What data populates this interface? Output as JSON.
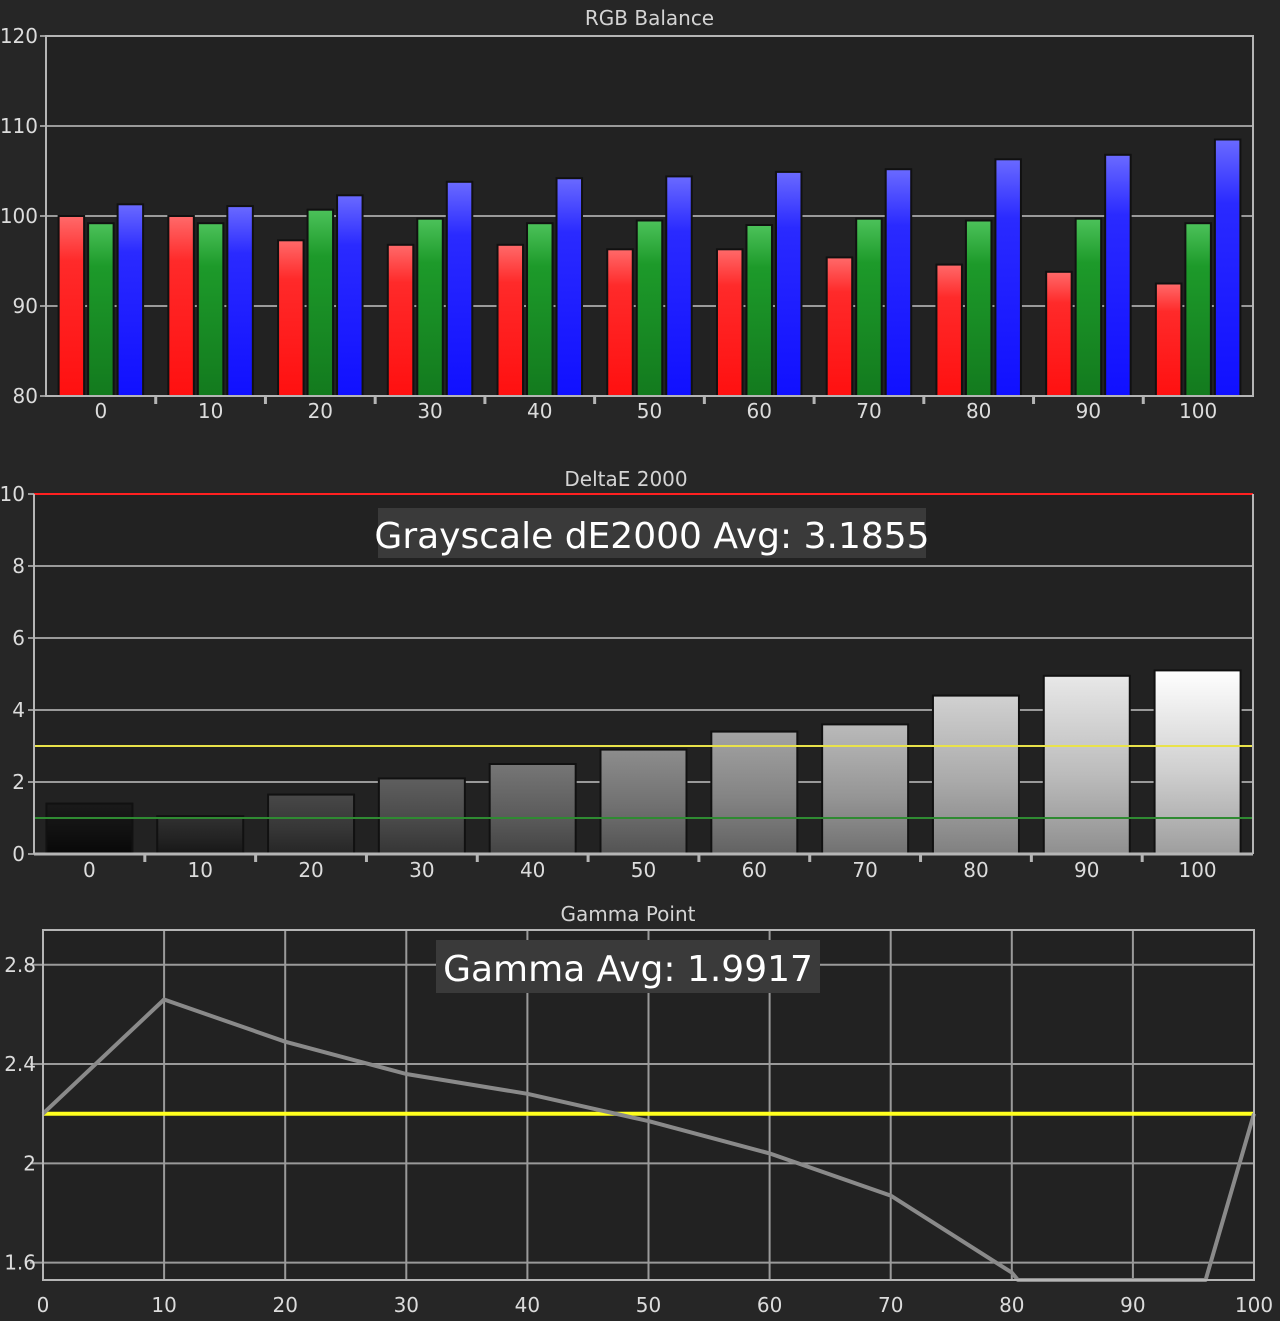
{
  "colors": {
    "background": "#262626",
    "plot_background": "#222222",
    "grid": "#9a9a9a",
    "frame": "#b5b5b5",
    "red_bar": "#ff2a2a",
    "green_bar": "#1d9a2a",
    "blue_bar": "#2a2aff",
    "gamma_line": "#8a8a8a",
    "target_yellow": "#ffff1e",
    "threshold_red": "#ff2020",
    "threshold_yellow": "#e9e24a",
    "threshold_green": "#2f8a32"
  },
  "chart_data": [
    {
      "type": "bar",
      "title": "RGB Balance",
      "categories": [
        "0",
        "10",
        "20",
        "30",
        "40",
        "50",
        "60",
        "70",
        "80",
        "90",
        "100"
      ],
      "series": [
        {
          "color": "red",
          "values": [
            100.0,
            100.0,
            97.3,
            96.8,
            96.8,
            96.3,
            96.3,
            95.4,
            94.6,
            93.8,
            92.5
          ]
        },
        {
          "color": "green",
          "values": [
            99.2,
            99.2,
            100.7,
            99.7,
            99.2,
            99.5,
            99.0,
            99.7,
            99.5,
            99.7,
            99.2
          ]
        },
        {
          "color": "blue",
          "values": [
            101.3,
            101.1,
            102.3,
            103.8,
            104.2,
            104.4,
            104.9,
            105.2,
            106.3,
            106.8,
            108.5
          ]
        }
      ],
      "ylim": [
        80,
        120
      ],
      "yticks": [
        "80",
        "90",
        "100",
        "110",
        "120"
      ],
      "grid": true
    },
    {
      "type": "bar",
      "title": "DeltaE 2000",
      "annotation": "Grayscale dE2000 Avg: 3.1855",
      "categories": [
        "0",
        "10",
        "20",
        "30",
        "40",
        "50",
        "60",
        "70",
        "80",
        "90",
        "100"
      ],
      "values": [
        1.4,
        1.05,
        1.65,
        2.1,
        2.5,
        2.9,
        3.4,
        3.6,
        4.4,
        4.95,
        5.1
      ],
      "ylim": [
        0,
        10
      ],
      "yticks": [
        "0",
        "2",
        "4",
        "6",
        "8",
        "10"
      ],
      "reference_lines": [
        10,
        3,
        1
      ],
      "grid": true
    },
    {
      "type": "line",
      "title": "Gamma Point",
      "annotation": "Gamma Avg: 1.9917",
      "x": [
        0,
        10,
        20,
        30,
        40,
        50,
        60,
        70,
        80,
        80.5,
        96,
        100
      ],
      "y": [
        2.2,
        2.66,
        2.49,
        2.36,
        2.28,
        2.17,
        2.04,
        1.87,
        1.56,
        1.53,
        1.53,
        2.2
      ],
      "target": 2.2,
      "xlim": [
        0,
        100
      ],
      "ylim": [
        1.53,
        2.94
      ],
      "xticks": [
        "0",
        "10",
        "20",
        "30",
        "40",
        "50",
        "60",
        "70",
        "80",
        "90",
        "100"
      ],
      "yticks": [
        {
          "value": 1.6,
          "label": "1.6"
        },
        {
          "value": 2.0,
          "label": "2"
        },
        {
          "value": 2.4,
          "label": "2.4"
        },
        {
          "value": 2.8,
          "label": "2.8"
        }
      ],
      "grid": true
    }
  ]
}
